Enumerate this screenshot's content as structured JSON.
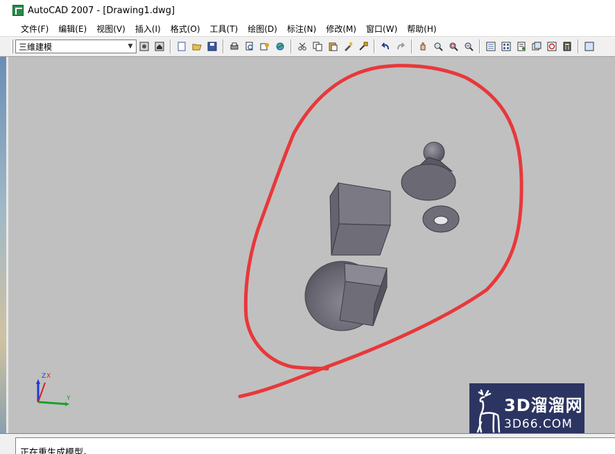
{
  "window": {
    "title": "AutoCAD 2007 - [Drawing1.dwg]"
  },
  "menu": {
    "items": [
      "文件(F)",
      "编辑(E)",
      "视图(V)",
      "插入(I)",
      "格式(O)",
      "工具(T)",
      "绘图(D)",
      "标注(N)",
      "修改(M)",
      "窗口(W)",
      "帮助(H)"
    ]
  },
  "toolbar": {
    "workspace_value": "三维建模",
    "icons": [
      "workspace-settings-icon",
      "workspace-home-icon",
      "new-icon",
      "open-icon",
      "save-icon",
      "plot-icon",
      "plot-preview-icon",
      "publish-icon",
      "3d-dwf-icon",
      "cut-icon",
      "copy-icon",
      "paste-icon",
      "match-properties-icon",
      "block-editor-icon",
      "undo-icon",
      "redo-icon",
      "pan-icon",
      "zoom-realtime-icon",
      "zoom-window-icon",
      "zoom-previous-icon",
      "properties-icon",
      "design-center-icon",
      "tool-palettes-icon",
      "sheet-set-icon",
      "markup-icon",
      "calculator-icon",
      "more-icon"
    ]
  },
  "ucs": {
    "x_label": "X",
    "y_label": "Y",
    "z_label": "Z"
  },
  "watermark": {
    "title": "3D溜溜网",
    "subtitle": "3D66.COM"
  },
  "command_line": {
    "text": "正在重生成模型。"
  },
  "colors": {
    "canvas": "#c0c0c0",
    "annotation": "#e8383a",
    "solid": "#6e6d78",
    "watermark_bg": "#2c3462"
  }
}
